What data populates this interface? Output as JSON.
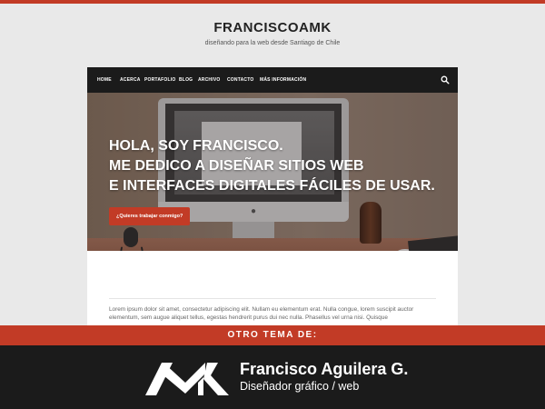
{
  "site": {
    "title": "FRANCISCOAMK",
    "tagline": "diseñando para la web desde Santiago de Chile"
  },
  "nav": {
    "items": [
      {
        "label": "HOME"
      },
      {
        "label": "ACERCA"
      },
      {
        "label": "PORTAFOLIO"
      },
      {
        "label": "BLOG"
      },
      {
        "label": "ARCHIVO"
      },
      {
        "label": "CONTACTO"
      },
      {
        "label": "MÁS INFORMACIÓN"
      }
    ],
    "search_icon": "search-icon"
  },
  "hero": {
    "line1": "HOLA, SOY FRANCISCO.",
    "line2": "ME DEDICO A DISEÑAR SITIOS WEB",
    "line3": "E INTERFACES DIGITALES FÁCILES DE USAR.",
    "cta_label": "¿Quieres trabajar conmigo?"
  },
  "content": {
    "paragraph": "Lorem ipsum dolor sit amet, consectetur adipiscing elit. Nullam eu elementum erat. Nulla congue, lorem suscipit auctor elementum, sem augue aliquet tellus, egestas hendrerit purus dui nec nulla. Phasellus vel urna nisi. Quisque"
  },
  "banner": {
    "label": "OTRO TEMA DE:"
  },
  "footer": {
    "logo_icon": "amk-logo",
    "name": "Francisco Aguilera G.",
    "role": "Diseñador gráfico / web"
  },
  "colors": {
    "accent": "#c23b26",
    "dark": "#1b1b1b",
    "background": "#e9e9e9"
  }
}
